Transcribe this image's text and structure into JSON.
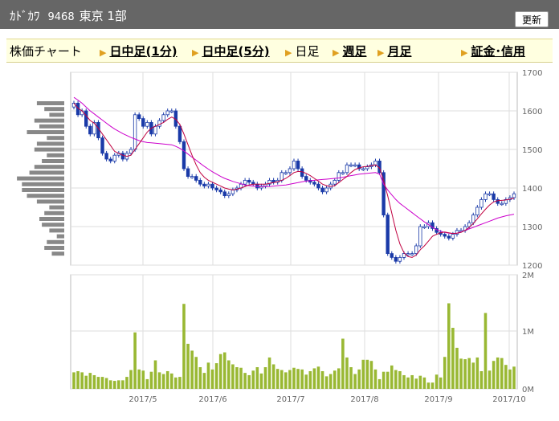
{
  "header": {
    "company": "ｶﾄﾞｶﾜ",
    "code": "9468",
    "market": "東京 1部",
    "update_label": "更新"
  },
  "nav": {
    "title": "株価チャート",
    "items": [
      {
        "label": "日中足(1分)",
        "link": true
      },
      {
        "label": "日中足(5分)",
        "link": true
      },
      {
        "label": "日足",
        "link": false
      },
      {
        "label": "週足",
        "link": true
      },
      {
        "label": "月足",
        "link": true
      },
      {
        "label": "証金･信用",
        "link": true
      }
    ]
  },
  "colors": {
    "up": "#ffffff",
    "down": "#1a3aa8",
    "ma_short": "#c00040",
    "ma_long": "#cc00cc",
    "volume": "#99b833",
    "volume_profile": "#888888"
  },
  "chart_data": [
    {
      "type": "candlestick",
      "x_ticks": [
        "2017/5",
        "2017/6",
        "2017/7",
        "2017/8",
        "2017/9",
        "2017/10"
      ],
      "y_ticks": [
        "1700",
        "1600",
        "1500",
        "1400",
        "1300",
        "1200"
      ],
      "ylim": [
        1200,
        1700
      ],
      "grid": true,
      "close": [
        1620,
        1590,
        1600,
        1560,
        1540,
        1570,
        1530,
        1490,
        1475,
        1470,
        1485,
        1490,
        1475,
        1490,
        1500,
        1590,
        1580,
        1560,
        1570,
        1540,
        1560,
        1575,
        1590,
        1600,
        1600,
        1560,
        1520,
        1450,
        1430,
        1430,
        1420,
        1410,
        1405,
        1410,
        1400,
        1395,
        1390,
        1380,
        1385,
        1395,
        1400,
        1410,
        1420,
        1415,
        1410,
        1400,
        1405,
        1410,
        1420,
        1415,
        1420,
        1440,
        1440,
        1450,
        1470,
        1450,
        1430,
        1420,
        1415,
        1410,
        1400,
        1390,
        1400,
        1410,
        1420,
        1440,
        1440,
        1460,
        1460,
        1460,
        1450,
        1450,
        1455,
        1460,
        1470,
        1440,
        1330,
        1230,
        1220,
        1210,
        1220,
        1230,
        1230,
        1230,
        1250,
        1300,
        1300,
        1310,
        1295,
        1285,
        1280,
        1275,
        1270,
        1280,
        1290,
        1290,
        1300,
        1310,
        1330,
        1350,
        1370,
        1385,
        1385,
        1370,
        1360,
        1360,
        1370,
        1375,
        1385
      ],
      "ma_short": [
        1620,
        1607,
        1600,
        1588,
        1575,
        1568,
        1555,
        1540,
        1525,
        1510,
        1495,
        1490,
        1485,
        1482,
        1485,
        1500,
        1515,
        1530,
        1545,
        1555,
        1560,
        1565,
        1570,
        1578,
        1584,
        1578,
        1565,
        1540,
        1512,
        1485,
        1460,
        1440,
        1428,
        1420,
        1415,
        1410,
        1405,
        1400,
        1397,
        1395,
        1397,
        1400,
        1404,
        1408,
        1410,
        1410,
        1410,
        1410,
        1412,
        1414,
        1416,
        1420,
        1425,
        1432,
        1440,
        1443,
        1442,
        1438,
        1432,
        1425,
        1418,
        1410,
        1406,
        1404,
        1406,
        1414,
        1422,
        1430,
        1440,
        1448,
        1452,
        1455,
        1456,
        1458,
        1460,
        1452,
        1420,
        1380,
        1335,
        1290,
        1255,
        1232,
        1222,
        1220,
        1226,
        1240,
        1250,
        1262,
        1275,
        1280,
        1284,
        1286,
        1284,
        1282,
        1283,
        1285,
        1290,
        1298,
        1308,
        1320,
        1333,
        1345,
        1356,
        1364,
        1367,
        1368,
        1369,
        1371,
        1374
      ],
      "ma_long": [
        1635,
        1628,
        1620,
        1610,
        1600,
        1592,
        1584,
        1576,
        1568,
        1560,
        1553,
        1547,
        1541,
        1536,
        1531,
        1527,
        1523,
        1520,
        1518,
        1517,
        1516,
        1515,
        1514,
        1513,
        1512,
        1508,
        1503,
        1496,
        1488,
        1480,
        1472,
        1464,
        1456,
        1449,
        1442,
        1436,
        1430,
        1425,
        1421,
        1417,
        1414,
        1411,
        1408,
        1406,
        1405,
        1404,
        1404,
        1404,
        1404,
        1405,
        1406,
        1407,
        1408,
        1410,
        1412,
        1414,
        1416,
        1418,
        1419,
        1420,
        1421,
        1422,
        1423,
        1424,
        1425,
        1426,
        1428,
        1430,
        1432,
        1434,
        1436,
        1437,
        1438,
        1439,
        1440,
        1436,
        1410,
        1395,
        1382,
        1370,
        1360,
        1352,
        1344,
        1336,
        1328,
        1320,
        1312,
        1305,
        1298,
        1292,
        1288,
        1285,
        1283,
        1282,
        1283,
        1286,
        1290,
        1294,
        1298,
        1302,
        1306,
        1310,
        1314,
        1318,
        1322,
        1325,
        1328,
        1330,
        1332
      ]
    },
    {
      "type": "bar",
      "name_ticks": [
        "2M",
        "1M",
        "0M"
      ],
      "ylim": [
        0,
        2000000
      ],
      "values": [
        0.29,
        0.31,
        0.29,
        0.23,
        0.28,
        0.24,
        0.21,
        0.21,
        0.19,
        0.15,
        0.14,
        0.15,
        0.15,
        0.21,
        0.33,
        0.99,
        0.34,
        0.32,
        0.17,
        0.3,
        0.5,
        0.29,
        0.26,
        0.31,
        0.27,
        0.2,
        0.21,
        1.49,
        0.79,
        0.67,
        0.56,
        0.38,
        0.28,
        0.46,
        0.34,
        0.45,
        0.61,
        0.64,
        0.5,
        0.43,
        0.38,
        0.37,
        0.28,
        0.24,
        0.32,
        0.38,
        0.27,
        0.38,
        0.55,
        0.43,
        0.35,
        0.33,
        0.29,
        0.33,
        0.37,
        0.35,
        0.34,
        0.25,
        0.31,
        0.36,
        0.39,
        0.31,
        0.22,
        0.26,
        0.32,
        0.36,
        0.88,
        0.55,
        0.38,
        0.26,
        0.34,
        0.51,
        0.51,
        0.49,
        0.34,
        0.17,
        0.3,
        0.3,
        0.41,
        0.33,
        0.31,
        0.24,
        0.2,
        0.24,
        0.18,
        0.23,
        0.2,
        0.11,
        0.11,
        0.25,
        0.2,
        0.56,
        1.5,
        1.07,
        0.72,
        0.53,
        0.52,
        0.54,
        0.46,
        0.55,
        0.31,
        1.33,
        0.32,
        0.49,
        0.55,
        0.54,
        0.42,
        0.34,
        0.39
      ]
    }
  ]
}
